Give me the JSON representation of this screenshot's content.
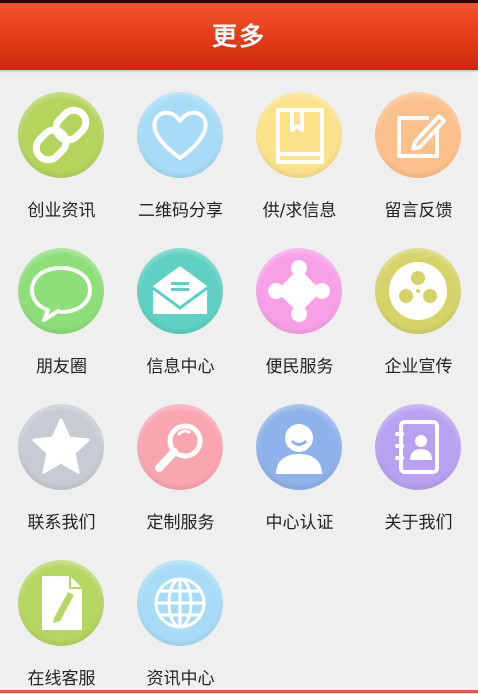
{
  "header": {
    "title": "更多"
  },
  "items": [
    {
      "label": "创业资讯",
      "icon": "chain-link-icon",
      "color": "#b5d45e"
    },
    {
      "label": "二维码分享",
      "icon": "heart-icon",
      "color": "#a8dcf6"
    },
    {
      "label": "供/求信息",
      "icon": "book-icon",
      "color": "#fbe28a"
    },
    {
      "label": "留言反馈",
      "icon": "edit-note-icon",
      "color": "#fcc08c"
    },
    {
      "label": "朋友圈",
      "icon": "speech-bubble-icon",
      "color": "#8ede7a"
    },
    {
      "label": "信息中心",
      "icon": "envelope-icon",
      "color": "#5fd0c2"
    },
    {
      "label": "便民服务",
      "icon": "puzzle-icon",
      "color": "#f7a0e8"
    },
    {
      "label": "企业宣传",
      "icon": "film-reel-icon",
      "color": "#d6d468"
    },
    {
      "label": "联系我们",
      "icon": "star-icon",
      "color": "#c7ccd4"
    },
    {
      "label": "定制服务",
      "icon": "magnifier-icon",
      "color": "#f9a6b0"
    },
    {
      "label": "中心认证",
      "icon": "user-icon",
      "color": "#8fb2ea"
    },
    {
      "label": "关于我们",
      "icon": "address-book-icon",
      "color": "#b9a1f1"
    },
    {
      "label": "在线客服",
      "icon": "document-pen-icon",
      "color": "#b6d662"
    },
    {
      "label": "资讯中心",
      "icon": "globe-icon",
      "color": "#a8dcf6"
    }
  ]
}
